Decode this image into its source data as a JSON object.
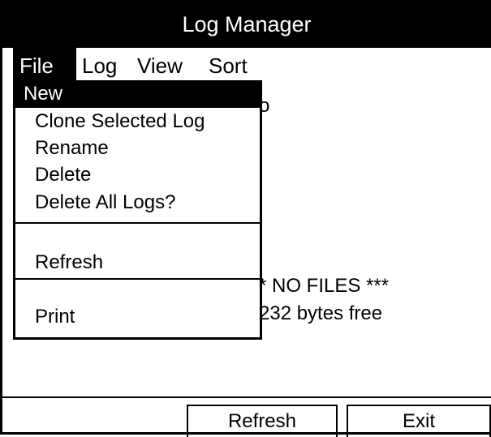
{
  "window": {
    "title": "Log Manager"
  },
  "menubar": {
    "items": [
      {
        "label": "File"
      },
      {
        "label": "Log"
      },
      {
        "label": "View"
      },
      {
        "label": "Sort"
      }
    ]
  },
  "file_menu": {
    "items": [
      {
        "label": "New"
      },
      {
        "label": "Clone Selected Log"
      },
      {
        "label": "Rename"
      },
      {
        "label": "Delete"
      },
      {
        "label": "Delete All Logs?"
      },
      {
        "label": "Refresh"
      },
      {
        "label": "Print"
      }
    ]
  },
  "content": {
    "partial_header": "o",
    "no_files": "* NO FILES ***",
    "free_space": "232 bytes free"
  },
  "softkeys": {
    "refresh": "Refresh",
    "exit": "Exit"
  }
}
